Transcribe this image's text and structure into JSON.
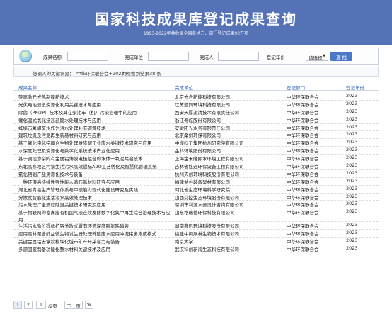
{
  "header": {
    "title": "国家科技成果库登记成果查询",
    "subtitle": "1993-2022年共收录全国各地方、部门登记成果92万项"
  },
  "search": {
    "name_label": "成果名称",
    "unit_label": "完成单位",
    "person_label": "完成人",
    "year_label": "登记年份",
    "year_value": "请选择",
    "button_label": "查 找",
    "name_value": "",
    "unit_value": "",
    "person_value": ""
  },
  "result": {
    "prefix": "您输入的关键词是：",
    "keyword": "中华环保联合会+2023+",
    "summary": "共检索到结果38 条"
  },
  "table": {
    "headers": [
      "成果名称",
      "完成单位",
      "登记部门",
      "登记年份"
    ],
    "rows": [
      {
        "name": "等离激元光热制膜新技术",
        "unit": "北京光合新能科技有限公司",
        "dept": "中华环保联合会",
        "year": "2023"
      },
      {
        "name": "光伏电池退役资源化利用关键技术与应用",
        "unit": "江苏道同环境科技有限公司",
        "dept": "中华环保联合会",
        "year": "2023"
      },
      {
        "name": "除菌（PM2P）技术及其在柴油车（机）污染治理中的应用",
        "unit": "西安天厚滤清技术有限责任公司",
        "dept": "中华环保联合会",
        "year": "2023"
      },
      {
        "name": "催化湿式氧化法高盐废水处理技术与应用",
        "unit": "浙江奇屹股份有限公司",
        "dept": "中华环保联合会",
        "year": "2023"
      },
      {
        "name": "蚌埠市氧甜废水作为污水处理补充碳源技术",
        "unit": "安徽阳光水务有限责任公司",
        "dept": "中华环保联合会",
        "year": "2023"
      },
      {
        "name": "建筑垃圾及污泥再生新基材料研究与应用",
        "unit": "北京桑剑环保有限公司",
        "dept": "中华环保联合会",
        "year": "2023"
      },
      {
        "name": "基于催化电化学耦合生物处理难降解工业废水关键技术研究与应用",
        "unit": "中煤科工集团杭州研究院有限公司",
        "dept": "中华环保联合会",
        "year": "2023"
      },
      {
        "name": "水深度处理及资源化与数字化系统技术产业化应用",
        "unit": "金科环境股份有限公司",
        "dept": "中华环保联合会",
        "year": "2023"
      },
      {
        "name": "基于调控渗杂的有金属铝薄膜电极组合的水体一氧泥共治技术",
        "unit": "上海金禾隆熙水环境工程有限公司",
        "dept": "中华环保联合会",
        "year": "2023"
      },
      {
        "name": "东北高寒地区村镇生活污水高效提标A2O工艺优化及智慧化管理系统",
        "unit": "吉林省悠远环保设备工程有限公司",
        "dept": "中华环保联合会",
        "year": "2023"
      },
      {
        "name": "氯化钙副产盐资源化技术与装备",
        "unit": "杭州天创环境科技股份有限公司",
        "dept": "中华环保联合会",
        "year": "2023"
      },
      {
        "name": "一种环保高持续性强性能人造石新材料研究与应用",
        "unit": "福建益谷装备型材有限公司",
        "dept": "中华环保联合会",
        "year": "2023"
      },
      {
        "name": "河北省青县生产管理体系与审核能力现代化建设研究及实践",
        "unit": "河北省生态环境科学研究院",
        "dept": "中华环保联合会",
        "year": "2023"
      },
      {
        "name": "分散式智能化生活污水高效处理技术",
        "unit": "山西交控生态环境股份有限公司",
        "dept": "中华环保联合会",
        "year": "2023"
      },
      {
        "name": "污水处理厂全流程除臭关键技术研究及应用",
        "unit": "深圳市利源水务设计咨询有限公司",
        "dept": "中华环保联合会",
        "year": "2023"
      },
      {
        "name": "基于物联网的畜禽废有机固气液连续发酵数字化集中再生综合治理技术与应用",
        "unit": "山东格瑞德环保科技有限公司",
        "dept": "中华环保联合会",
        "year": "2023"
      },
      {
        "name": "生活污水微位提标扩容分散式臀向环流深度脱氮除磷装",
        "unit": "湖南鑫远环境科技股份有限公司",
        "dept": "中华环保联合会",
        "year": "2023"
      },
      {
        "name": "应用腐林聚合韵益微生物发生器处理养殖废水应用冲洗猪舍集成模式",
        "unit": "福建中闽展林生物技术有限公司",
        "dept": "中华环保联合会",
        "year": "2023"
      },
      {
        "name": "关键金属钴去掌钦模块化城市矿产开采容力与装备",
        "unit": "南京大学",
        "dept": "中华环保联合会",
        "year": "2023"
      },
      {
        "name": "多源固废制备功能化整水材料关键技术及应用",
        "unit": "武汉科创新海生态科技有限公司",
        "dept": "中华环保联合会",
        "year": "2023"
      }
    ]
  },
  "pager": {
    "page1": "1",
    "page2": "2",
    "goto_value": "1",
    "total": "/2页",
    "next": "下一页",
    "last": "≫"
  },
  "colors": {
    "banner": "#5572b6",
    "button": "#4a79c8",
    "header_text": "#2c66b8"
  },
  "icons": {
    "logo": "magnifier-globe-icon",
    "select": "chevron-down-icon"
  }
}
